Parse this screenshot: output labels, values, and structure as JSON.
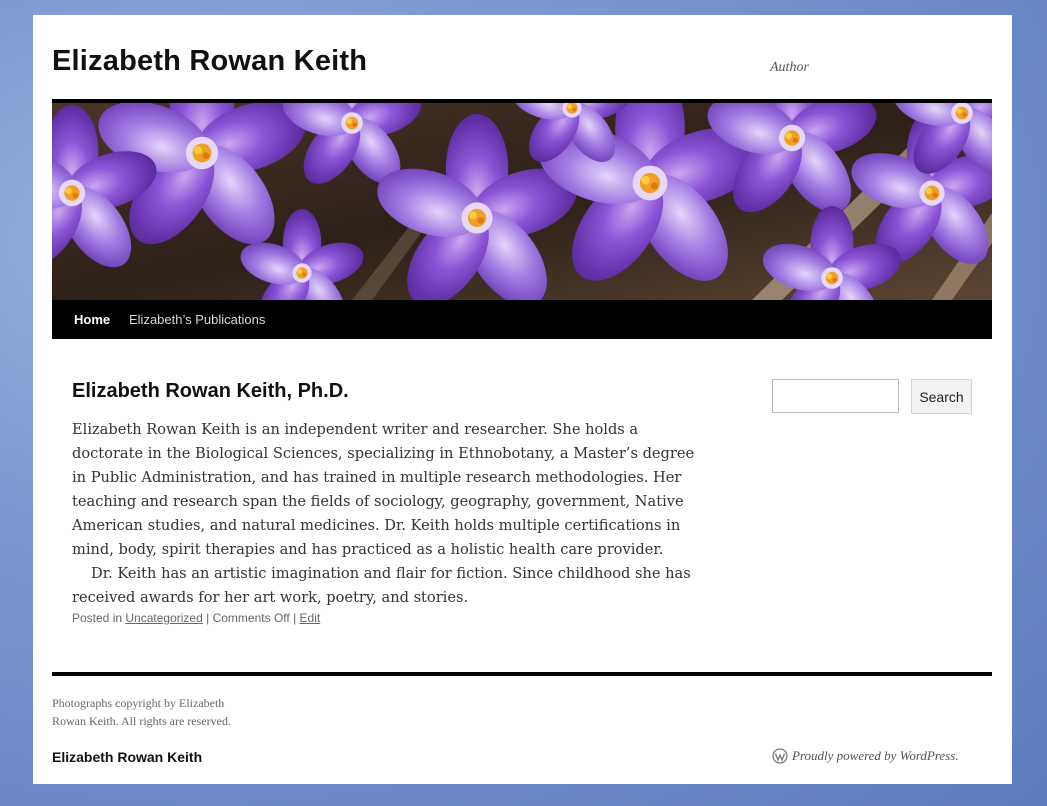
{
  "site": {
    "title": "Elizabeth Rowan Keith",
    "description": "Author"
  },
  "nav": {
    "items": [
      {
        "label": "Home"
      },
      {
        "label": "Elizabeth’s Publications"
      }
    ]
  },
  "search": {
    "placeholder": "",
    "button_label": "Search"
  },
  "post": {
    "title": "Elizabeth Rowan Keith, Ph.D.",
    "paragraphs": [
      "Elizabeth Rowan Keith is an independent writer and researcher. She holds a doctorate in the Biological Sciences, specializing in Ethnobotany, a Master’s degree in Public Administration, and has trained in multiple research methodologies. Her teaching and research span the fields of sociology, geography, government, Native American studies, and natural medicines. Dr. Keith holds multiple certifications in mind, body, spirit therapies and has practiced as a holistic health care provider.",
      "Dr. Keith has an artistic imagination and flair for fiction. Since childhood she has received awards for her art work, poetry, and stories."
    ],
    "meta": {
      "posted_in": "Posted in",
      "category": "Uncategorized",
      "sep1": "|",
      "comments": "Comments Off",
      "sep2": "|",
      "edit": "Edit"
    }
  },
  "footer": {
    "widget_text_1": "Photographs copyright by Elizabeth",
    "widget_text_2": "Rowan Keith. All rights are reserved.",
    "site_title": "Elizabeth Rowan Keith",
    "powered_by": "Proudly powered by WordPress."
  },
  "colors": {
    "background": "#6b89c8",
    "page": "#ffffff",
    "nav_bar": "#000000",
    "flower_purple": "#7b45c9"
  },
  "icons": {
    "powered": "wordpress-icon"
  }
}
